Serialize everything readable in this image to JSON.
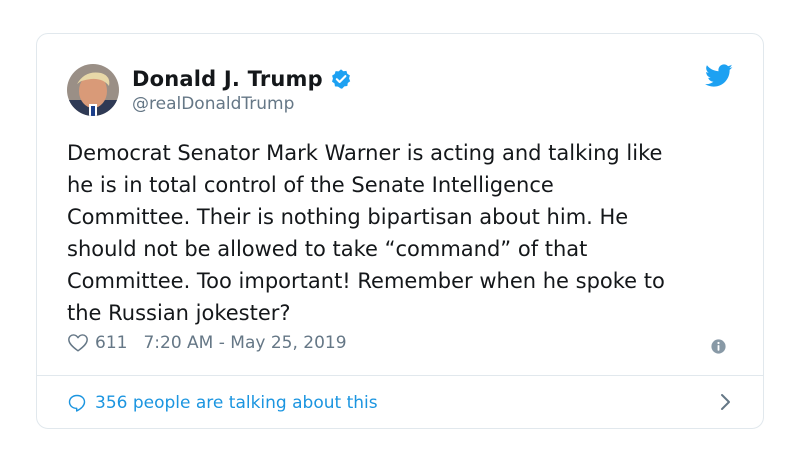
{
  "tweet": {
    "author_name": "Donald J. Trump",
    "handle": "@realDonaldTrump",
    "text": "Democrat Senator Mark Warner is acting and talking like\nhe is in total control of the Senate Intelligence\nCommittee. Their is nothing bipartisan about him. He\nshould not be allowed to take “command” of that\nCommittee. Too important! Remember when he spoke to\nthe Russian jokester?",
    "likes": "611",
    "timestamp": "7:20 AM - May 25, 2019",
    "talking_text": "356 people are talking about this"
  },
  "icons": {
    "avatar": "avatar",
    "verified": "verified-badge-icon",
    "brand": "twitter-bird-icon",
    "like": "heart-icon",
    "info": "info-icon",
    "reply": "speech-bubble-icon",
    "chevron": "chevron-right-icon"
  },
  "colors": {
    "text": "#14171a",
    "secondary": "#657786",
    "accent": "#1da1f2",
    "link": "#1b95e0",
    "border": "#e1e8ed"
  }
}
